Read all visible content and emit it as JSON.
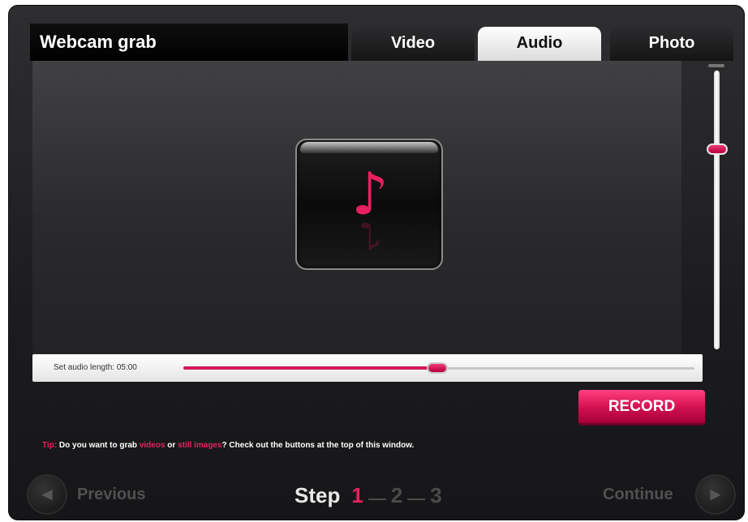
{
  "app": {
    "title": "Webcam grab"
  },
  "tabs": [
    {
      "label": "Video",
      "active": false
    },
    {
      "label": "Audio",
      "active": true
    },
    {
      "label": "Photo",
      "active": false
    }
  ],
  "stage": {
    "icon": "music-note-icon",
    "glyph": "♪"
  },
  "volume": {
    "level": 0.28
  },
  "audio_length": {
    "label": "Set audio length: 05:00",
    "position": 0.5
  },
  "record_button": {
    "label": "RECORD"
  },
  "tip": {
    "prefix": "Tip:",
    "part1": " Do you want to grab ",
    "link_videos": "videos",
    "part2": " or ",
    "link_images": "still images",
    "part3": "? Check out the buttons at the top of this window."
  },
  "nav": {
    "previous_label": "Previous",
    "continue_label": "Continue",
    "step_word": "Step",
    "steps": [
      "1",
      "2",
      "3"
    ],
    "current_step": "1"
  },
  "colors": {
    "accent": "#e8205f",
    "active_tab": "#ffffff"
  }
}
